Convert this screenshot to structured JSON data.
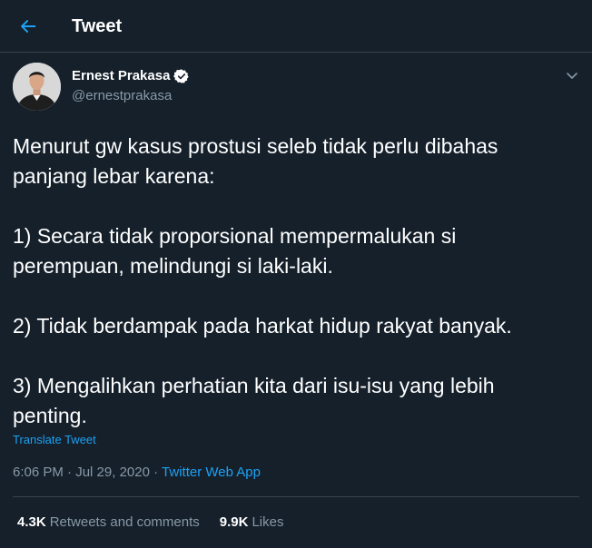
{
  "header": {
    "title": "Tweet"
  },
  "author": {
    "name": "Ernest Prakasa",
    "handle": "@ernestprakasa"
  },
  "tweet": {
    "lines": [
      "Menurut gw kasus prostusi seleb tidak perlu dibahas",
      "panjang lebar karena:",
      "",
      "1) Secara tidak proporsional mempermalukan si",
      "perempuan, melindungi si laki-laki.",
      "",
      "2) Tidak berdampak pada harkat hidup rakyat banyak.",
      "",
      "3) Mengalihkan perhatian kita dari isu-isu yang lebih",
      "penting."
    ],
    "translate": "Translate Tweet"
  },
  "meta": {
    "time": "6:06 PM",
    "date": "Jul 29, 2020",
    "separator": "·",
    "app": "Twitter Web App"
  },
  "stats": {
    "retweets_count": "4.3K",
    "retweets_label": "Retweets and comments",
    "likes_count": "9.9K",
    "likes_label": "Likes"
  },
  "icons": {
    "back": "back-arrow-icon",
    "verified": "verified-badge-icon",
    "caret": "chevron-down-icon"
  },
  "colors": {
    "background": "#15202b",
    "accent": "#1da1f2",
    "secondary_text": "#8899a6",
    "border": "#38444d"
  }
}
